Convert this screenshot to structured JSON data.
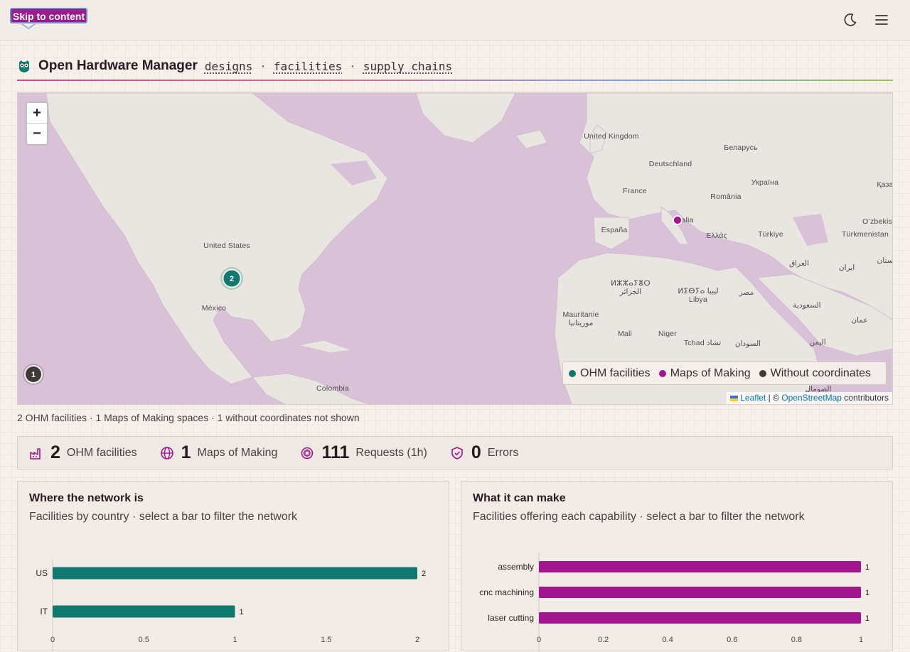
{
  "skip_link": "Skip to content",
  "header": {
    "app_title": "Open Hardware Manager",
    "nav": [
      "designs",
      "facilities",
      "supply chains"
    ],
    "nav_separator": "·"
  },
  "map": {
    "zoom_in": "+",
    "zoom_out": "−",
    "labels": {
      "uk": "United Kingdom",
      "belarus": "Беларусь",
      "germany": "Deutschland",
      "ukraine": "Україна",
      "kazakhstan": "Қаза",
      "france": "France",
      "romania": "România",
      "uzbekistan": "Oʻzbekis",
      "italy": "alia",
      "spain": "España",
      "greece": "Ελλάς",
      "turkey": "Türkiye",
      "turkmenistan": "Türkmenistan",
      "afghanistan": "ستان",
      "usa": "United States",
      "iraq": "العراق",
      "iran": "ایران",
      "algeria_tf": "ⵍⵣⵣⴰⵢⴻⵔ",
      "algeria_ar": "الجزائر",
      "libya_tf": "ⵍⵉⴱⵢⴰ ليبيا",
      "libya": "Libya",
      "egypt": "مصر",
      "saudi": "السعودية",
      "mexico": "México",
      "mauritania": "Mauritanie",
      "mauritania_ar": "موريتانيا",
      "mali": "Mali",
      "niger": "Niger",
      "chad": "Tchad تشاد",
      "sudan": "السودان",
      "oman": "عمان",
      "yemen": "اليمن",
      "somalia": "الصومال",
      "colombia": "Colombia"
    },
    "cluster_ohm": "2",
    "cluster_nocoord": "1",
    "legend": {
      "ohm": "OHM facilities",
      "mom": "Maps of Making",
      "nocoord": "Without coordinates"
    },
    "attribution": {
      "leaflet": "Leaflet",
      "sep": "| ©",
      "osm": "OpenStreetMap",
      "contrib": "contributors"
    }
  },
  "caption": "2 OHM facilities · 1 Maps of Making spaces · 1 without coordinates not shown",
  "stats": [
    {
      "value": "2",
      "label": "OHM facilities"
    },
    {
      "value": "1",
      "label": "Maps of Making"
    },
    {
      "value": "111",
      "label": "Requests (1h)"
    },
    {
      "value": "0",
      "label": "Errors"
    }
  ],
  "colors": {
    "ohm": "#10786f",
    "mom": "#a1168f",
    "nocoord": "#3f3a38",
    "accent": "#9b1a8c"
  },
  "panels": {
    "country": {
      "title": "Where the network is",
      "subtitle": "Facilities by country · select a bar to filter the network"
    },
    "capability": {
      "title": "What it can make",
      "subtitle": "Facilities offering each capability · select a bar to filter the network"
    }
  },
  "chart_data": [
    {
      "type": "bar",
      "orientation": "horizontal",
      "categories": [
        "US",
        "IT"
      ],
      "values": [
        2,
        1
      ],
      "xlim": [
        0,
        2
      ],
      "xticks": [
        "0",
        "0.5",
        "1",
        "1.5",
        "2"
      ],
      "color": "#10786f"
    },
    {
      "type": "bar",
      "orientation": "horizontal",
      "categories": [
        "assembly",
        "cnc machining",
        "laser cutting"
      ],
      "values": [
        1,
        1,
        1
      ],
      "xlim": [
        0,
        1
      ],
      "xticks": [
        "0",
        "0.2",
        "0.4",
        "0.6",
        "0.8",
        "1"
      ],
      "color": "#a1168f"
    }
  ]
}
